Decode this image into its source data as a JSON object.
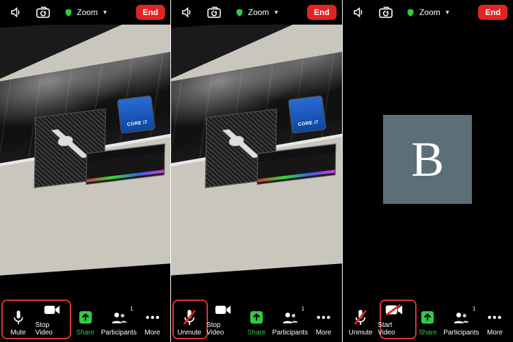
{
  "app": {
    "name": "Zoom",
    "end_label": "End"
  },
  "panes": [
    {
      "video_on": true,
      "highlight": "mute-and-video-group",
      "avatar_initial": "",
      "bottom": {
        "mic": {
          "label": "Mute",
          "muted": false
        },
        "video": {
          "label": "Stop Video",
          "off": false
        },
        "share": {
          "label": "Share"
        },
        "part": {
          "label": "Participants",
          "count": "1"
        },
        "more": {
          "label": "More"
        }
      }
    },
    {
      "video_on": true,
      "highlight": "mute-only",
      "avatar_initial": "",
      "bottom": {
        "mic": {
          "label": "Unmute",
          "muted": true
        },
        "video": {
          "label": "Stop Video",
          "off": false
        },
        "share": {
          "label": "Share"
        },
        "part": {
          "label": "Participants",
          "count": "1"
        },
        "more": {
          "label": "More"
        }
      }
    },
    {
      "video_on": false,
      "highlight": "video-only",
      "avatar_initial": "B",
      "bottom": {
        "mic": {
          "label": "Unmute",
          "muted": true
        },
        "video": {
          "label": "Start Video",
          "off": true
        },
        "share": {
          "label": "Share"
        },
        "part": {
          "label": "Participants",
          "count": "1"
        },
        "more": {
          "label": "More"
        }
      }
    }
  ]
}
